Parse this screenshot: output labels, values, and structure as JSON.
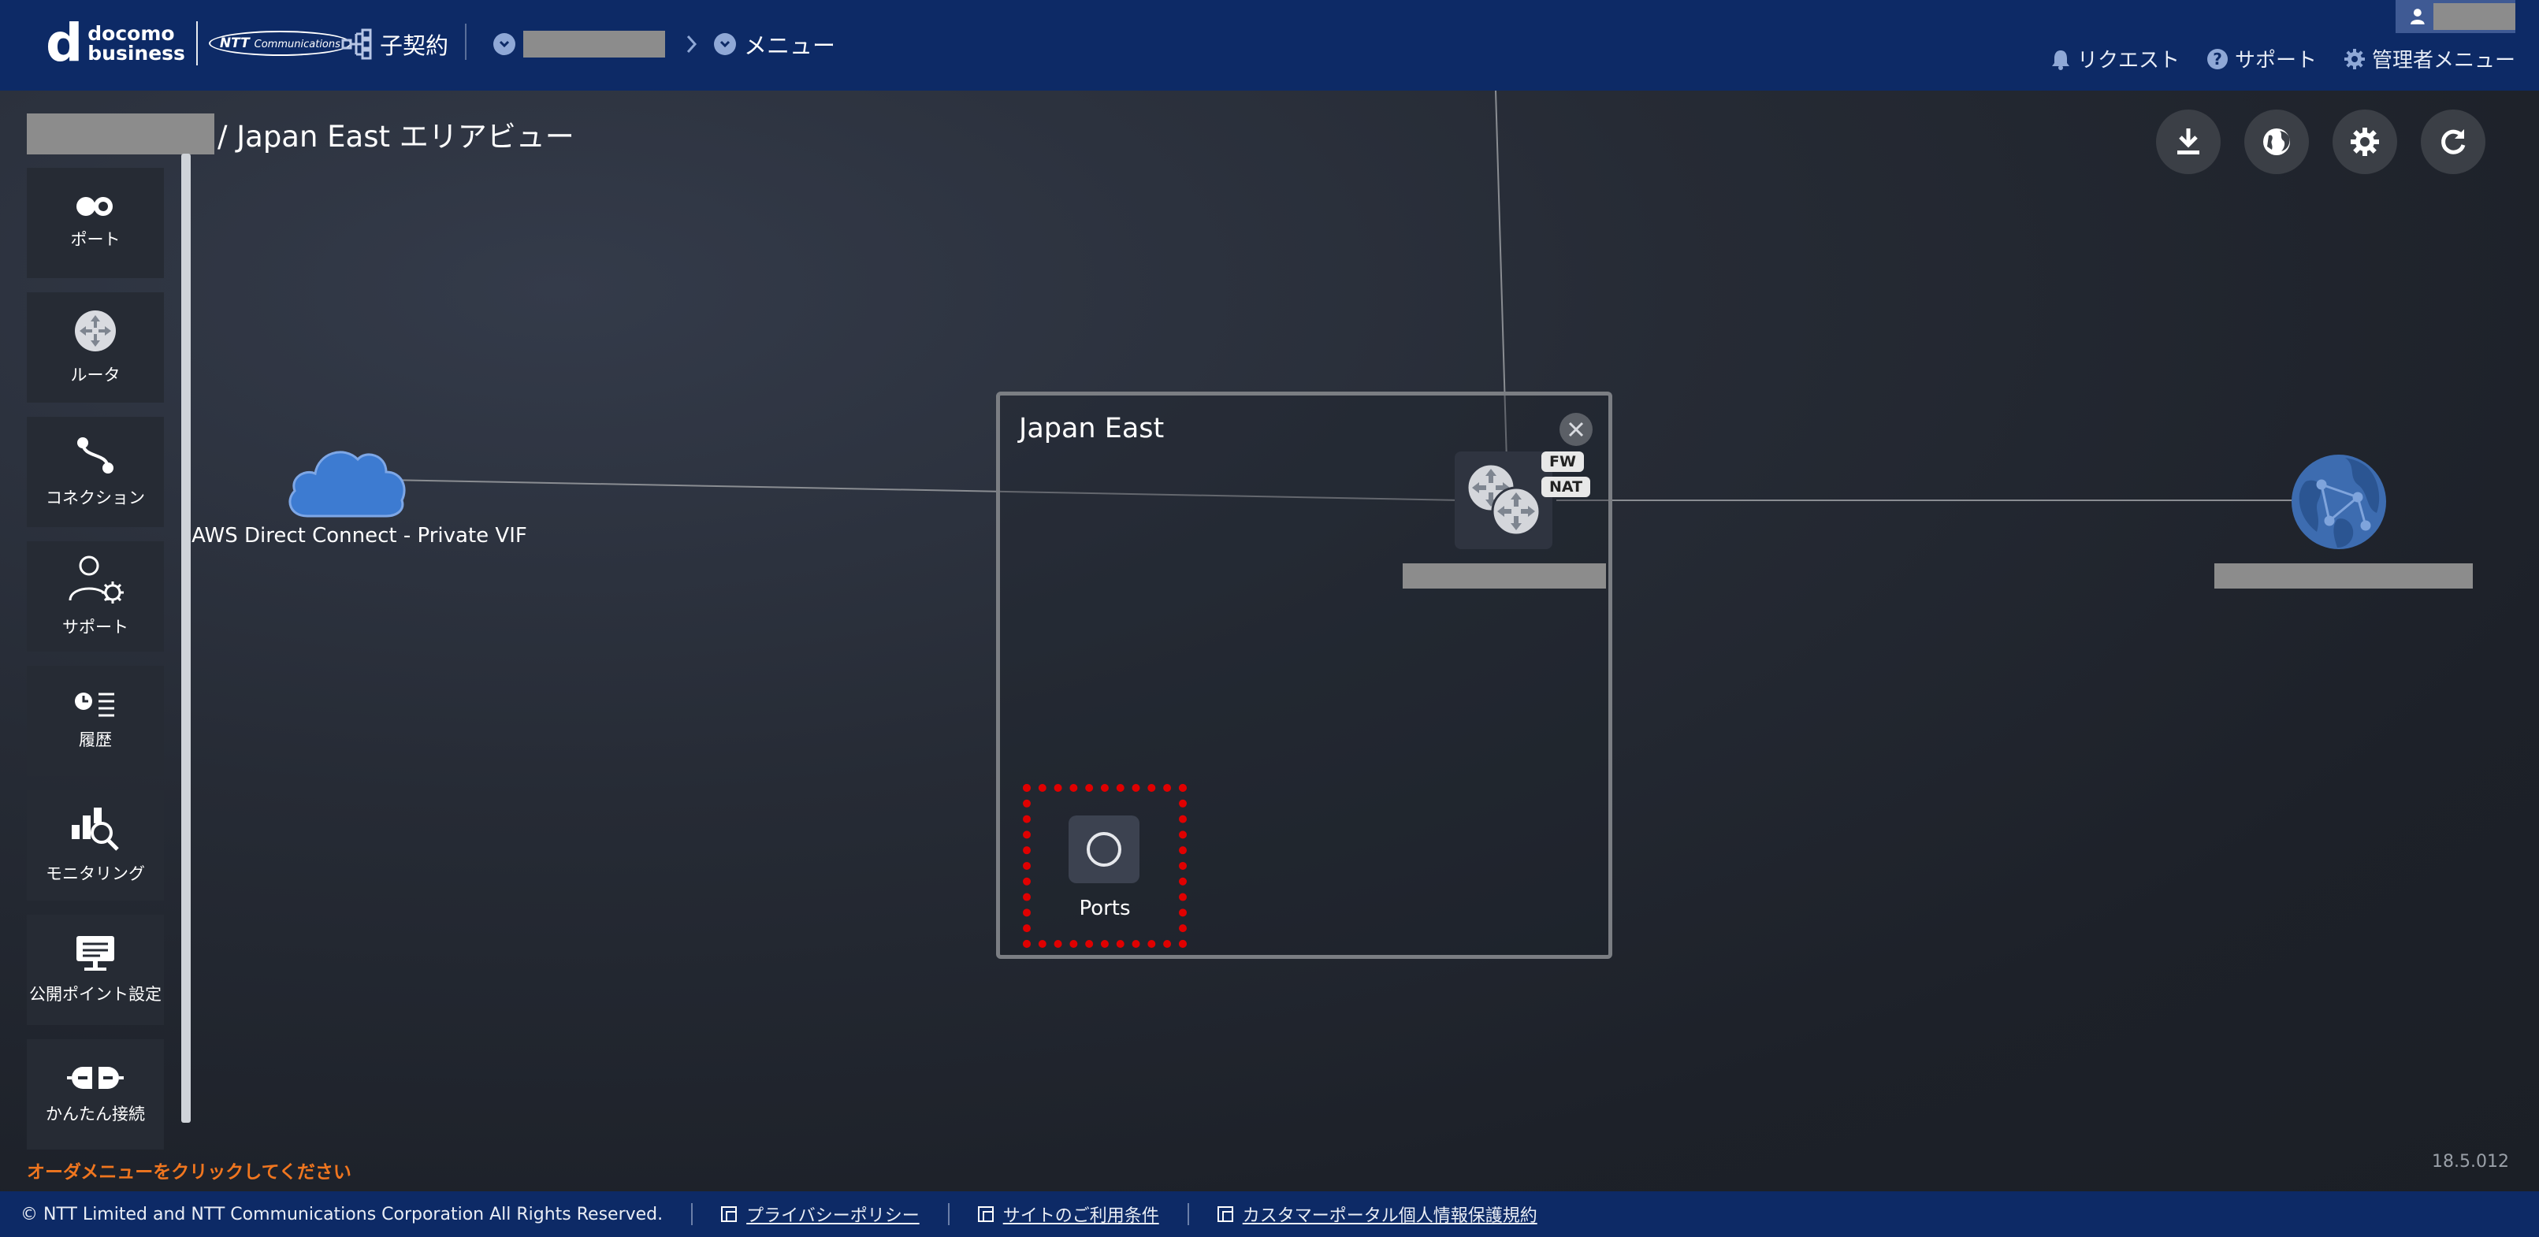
{
  "header": {
    "logo": {
      "brand_line1": "docomo",
      "brand_line2": "business",
      "partner": "NTT",
      "partner_sub": "Communications"
    },
    "contract_label": "子契約",
    "menu_label": "メニュー",
    "right_links": [
      {
        "label": "リクエスト",
        "icon": "bell-icon"
      },
      {
        "label": "サポート",
        "icon": "help-icon"
      },
      {
        "label": "管理者メニュー",
        "icon": "gear-icon"
      }
    ]
  },
  "page": {
    "title": "/ Japan East エリアビュー"
  },
  "sidebar": {
    "items": [
      {
        "label": "ポート",
        "icon": "port-icon"
      },
      {
        "label": "ルータ",
        "icon": "router-icon"
      },
      {
        "label": "コネクション",
        "icon": "connection-icon"
      },
      {
        "label": "サポート",
        "icon": "support-icon"
      },
      {
        "label": "履歴",
        "icon": "history-icon"
      },
      {
        "label": "モニタリング",
        "icon": "monitoring-icon"
      },
      {
        "label": "公開ポイント設定",
        "icon": "public-point-icon"
      },
      {
        "label": "かんたん接続",
        "icon": "easy-connect-icon"
      }
    ],
    "hint": "オーダメニューをクリックしてください"
  },
  "toolbar": {
    "buttons": [
      {
        "name": "download",
        "icon": "download-icon"
      },
      {
        "name": "globe",
        "icon": "globe-icon"
      },
      {
        "name": "settings",
        "icon": "gear-icon"
      },
      {
        "name": "refresh",
        "icon": "refresh-icon"
      }
    ]
  },
  "diagram": {
    "cloud_label": "AWS Direct Connect - Private VIF",
    "area_title": "Japan East",
    "router_tags": [
      "FW",
      "NAT"
    ],
    "ports_label": "Ports"
  },
  "version": "18.5.012",
  "footer": {
    "copyright": "© NTT Limited and NTT Communications Corporation All Rights Reserved.",
    "links": [
      "プライバシーポリシー",
      "サイトのご利用条件",
      "カスタマーポータル個人情報保護規約"
    ]
  },
  "colors": {
    "header_bg": "#0d2a66",
    "highlight": "#e00000",
    "hint": "#f0761f",
    "node_blue": "#3d7bd1"
  }
}
